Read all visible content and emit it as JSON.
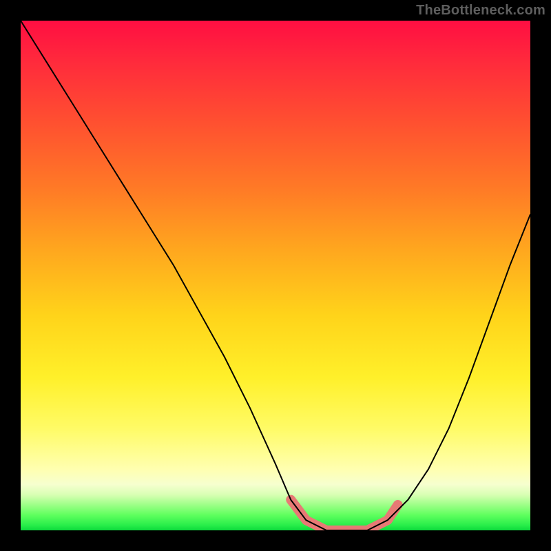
{
  "watermark": "TheBottleneck.com",
  "chart_data": {
    "type": "line",
    "title": "",
    "xlabel": "",
    "ylabel": "",
    "xlim": [
      0,
      100
    ],
    "ylim": [
      0,
      100
    ],
    "grid": false,
    "legend": false,
    "series": [
      {
        "name": "bottleneck-curve",
        "x": [
          0,
          5,
          10,
          15,
          20,
          25,
          30,
          35,
          40,
          45,
          50,
          53,
          56,
          60,
          64,
          68,
          72,
          76,
          80,
          84,
          88,
          92,
          96,
          100
        ],
        "y": [
          100,
          92,
          84,
          76,
          68,
          60,
          52,
          43,
          34,
          24,
          13,
          6,
          2,
          0,
          0,
          0,
          2,
          6,
          12,
          20,
          30,
          41,
          52,
          62
        ]
      }
    ],
    "highlight": {
      "name": "optimal-range",
      "points": [
        {
          "x": 53,
          "y": 6
        },
        {
          "x": 56,
          "y": 2
        },
        {
          "x": 60,
          "y": 0
        },
        {
          "x": 64,
          "y": 0
        },
        {
          "x": 68,
          "y": 0
        },
        {
          "x": 72,
          "y": 2
        },
        {
          "x": 74,
          "y": 5
        }
      ],
      "color": "#e77975"
    },
    "background_gradient": {
      "orientation": "vertical",
      "stops": [
        {
          "pos": 0.0,
          "color": "#ff0e42"
        },
        {
          "pos": 0.33,
          "color": "#ff7a26"
        },
        {
          "pos": 0.58,
          "color": "#ffd41a"
        },
        {
          "pos": 0.88,
          "color": "#ffffb0"
        },
        {
          "pos": 0.95,
          "color": "#9dff87"
        },
        {
          "pos": 1.0,
          "color": "#0cd93c"
        }
      ]
    }
  }
}
